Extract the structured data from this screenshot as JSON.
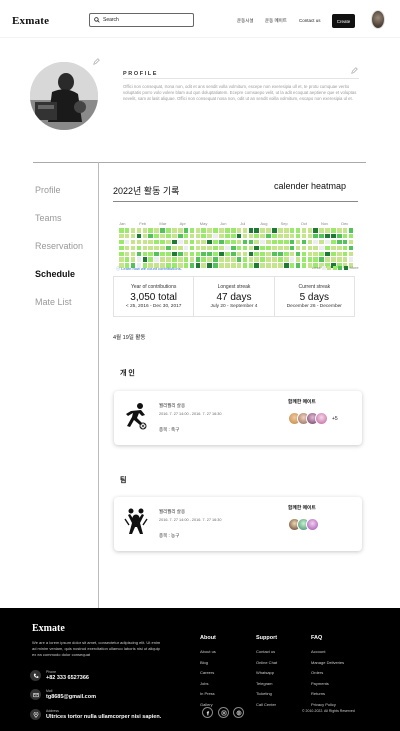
{
  "header": {
    "logo": "Exmate",
    "search_placeholder": "Search",
    "nav": [
      {
        "label": "운동시설",
        "name": "nav-facilities"
      },
      {
        "label": "운동 메이트",
        "name": "nav-workout-mate"
      },
      {
        "label": "Contact us",
        "name": "nav-contact-us"
      }
    ],
    "create_label": "Create"
  },
  "profile": {
    "label": "PROFILE",
    "text": "Offici non consequat, Irona non, odit et ans sendit volla volmitum, escepe non exeresipia ull et, te protu cumquae verito voluptatis porro volo volere blam aut qun doluptatiatem. Ecepre comsaepo velit, ut la adit ecoquat aeptiene que et voluptas nevelit, sam at lasit aliquae. Offici non consequat nosa non, odit ut an sendit voilla volmitum, escapo non exeresipia ul et."
  },
  "sidebar": {
    "items": [
      {
        "label": "Profile",
        "name": "sidebar-item-profile"
      },
      {
        "label": "Teams",
        "name": "sidebar-item-teams"
      },
      {
        "label": "Reservation",
        "name": "sidebar-item-reservation"
      },
      {
        "label": "Schedule",
        "name": "sidebar-item-schedule",
        "active": true
      },
      {
        "label": "Mate List",
        "name": "sidebar-item-mate-list"
      }
    ]
  },
  "activity": {
    "title": "2022년 활동 기록",
    "heatmap_title": "calender heatmap",
    "months": [
      "Jan",
      "Feb",
      "Mar",
      "Apr",
      "May",
      "Jun",
      "Jul",
      "Aug",
      "Sep",
      "Oct",
      "Nov",
      "Dec"
    ],
    "how_link": "Learn how we count contributions.",
    "legend_less": "Less",
    "legend_more": "More",
    "colors": {
      "level0": "#ebedf0",
      "level1": "#c6e48b",
      "level2": "#9be96b",
      "level3": "#53c25a",
      "level4": "#1e7b34"
    }
  },
  "stats": [
    {
      "label": "Year of contributions",
      "value": "3,050 total",
      "range": "< 25, 2016 - Dec 30, 2017"
    },
    {
      "label": "Longest streak",
      "value": "47 days",
      "range": "July 20 - September 4"
    },
    {
      "label": "Current streak",
      "value": "5 days",
      "range": "December 26 - December"
    }
  ],
  "date_label": "4월 19일 활동",
  "sections": {
    "personal": "개 인",
    "team": "팀"
  },
  "cards": [
    {
      "title": "월리월리 살옹",
      "date": "2016. 7. 27 14:00 - 2016. 7. 27 16:30",
      "type": "종목 : 축구",
      "mates_label": "함께한 메이트",
      "more": "+5"
    },
    {
      "title": "월리월리 살옹",
      "date": "2016. 7. 27 14:00 - 2016. 7. 27 16:30",
      "type": "종목 : 농구",
      "mates_label": "함께한 메이트",
      "more": ""
    }
  ],
  "footer": {
    "logo": "Exmate",
    "desc": "We are a lorem ipsum dolor sit amet, consectetur adipiscing elit. Ut enim ad minim veniam, quis nostrud exercitation ullamco laboris nisi ut aliquip ex ea commodo dolor consequat",
    "phone_label": "Phone",
    "phone": "+82 333 6527366",
    "mail_label": "Mail",
    "mail": "tg8685@gmail.com",
    "address_label": "Address",
    "address": "Ultrices tortor nulla ullamcorper nisi sapien.",
    "columns": [
      {
        "title": "About",
        "links": [
          "About us",
          "Blog",
          "Careers",
          "Jobs",
          "In Press",
          "Gallery"
        ]
      },
      {
        "title": "Support",
        "links": [
          "Contact us",
          "Online Chat",
          "Whatsapp",
          "Telegram",
          "Ticketing",
          "Call Center"
        ]
      },
      {
        "title": "FAQ",
        "links": [
          "Account",
          "Manage Deliveries",
          "Orders",
          "Payments",
          "Returns",
          "Privacy Policy"
        ]
      }
    ],
    "copyright": "© 2010-2022. All Rights Reserved"
  }
}
